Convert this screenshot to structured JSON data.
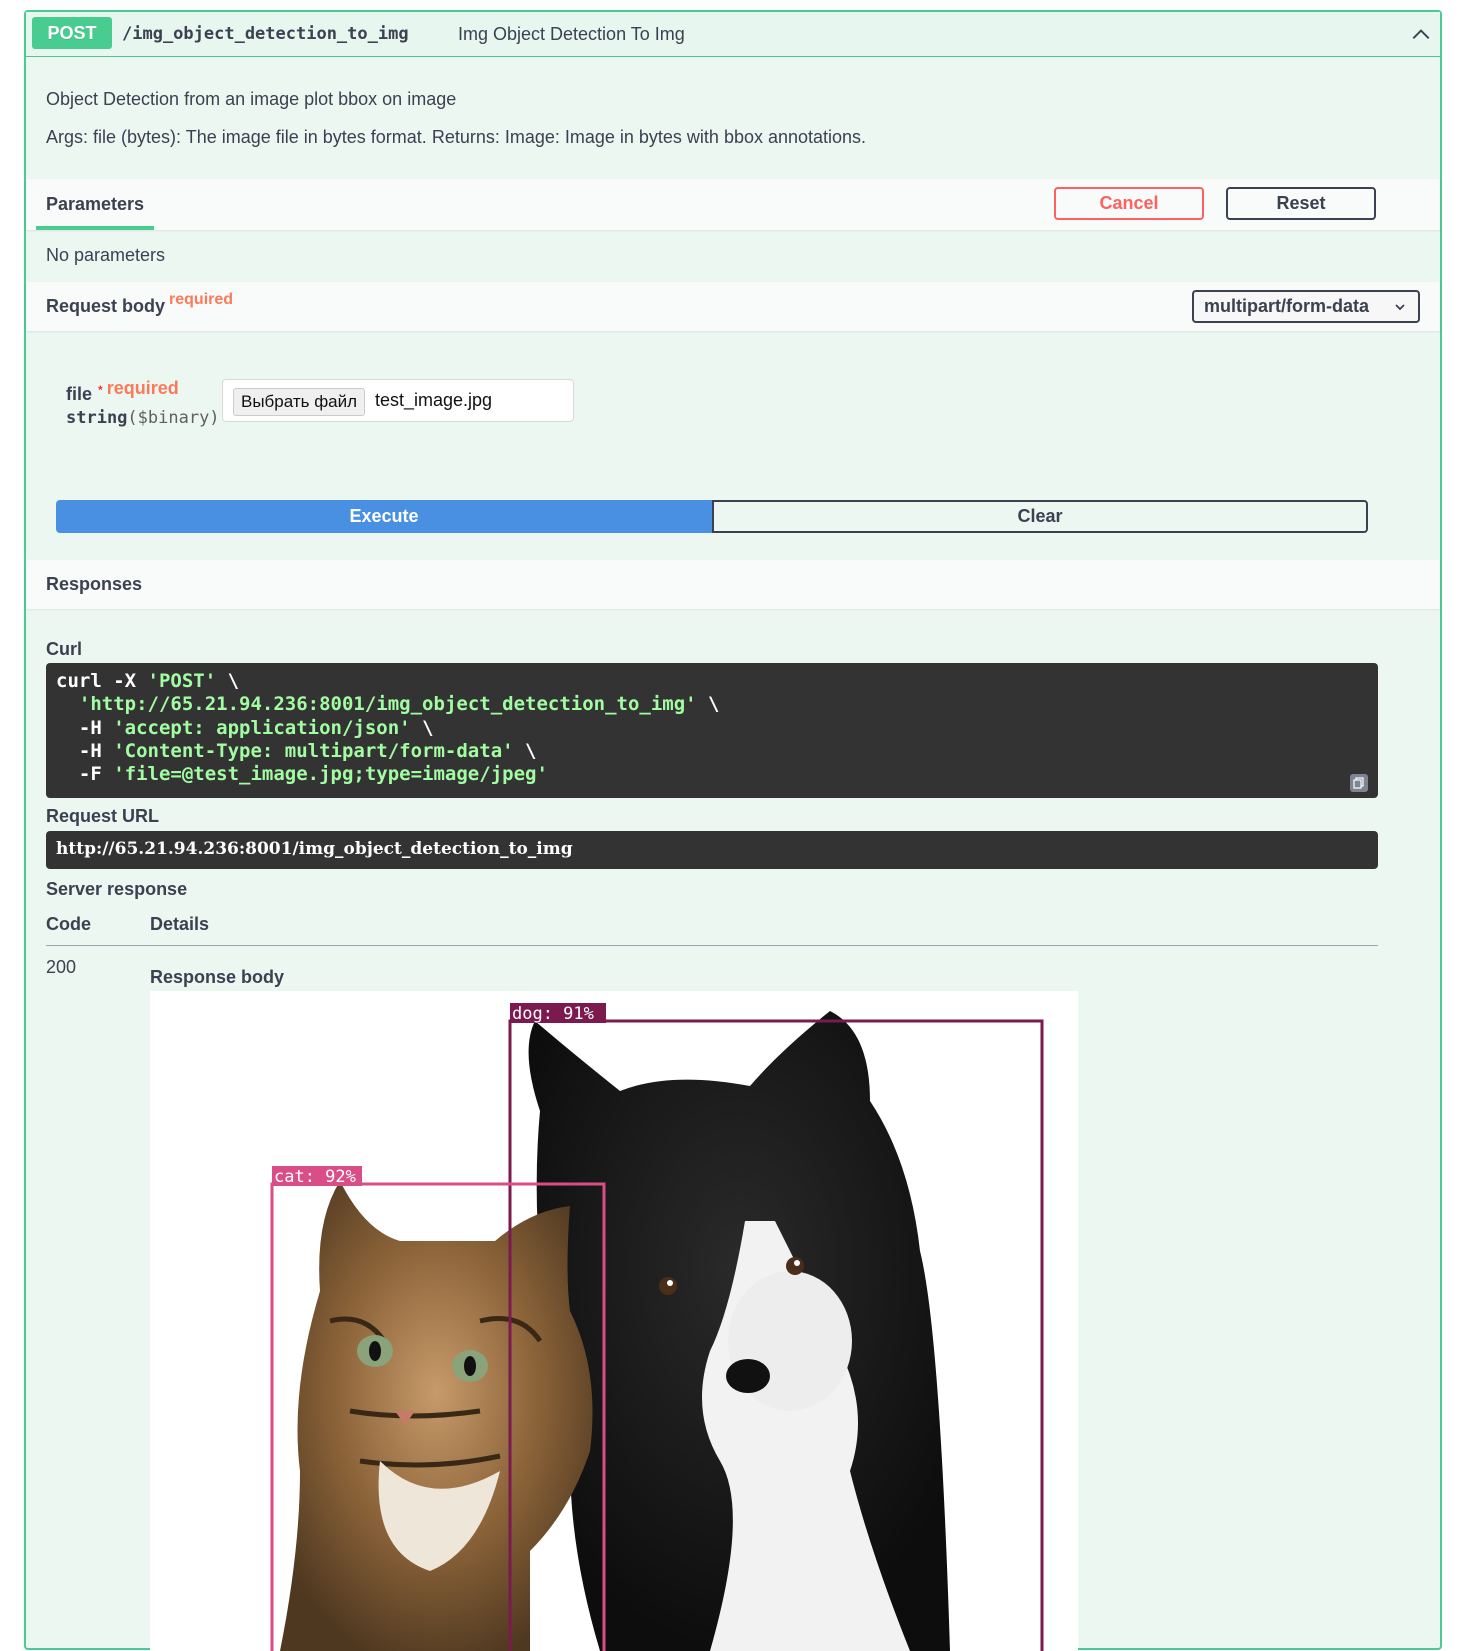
{
  "operation": {
    "method": "POST",
    "path": "/img_object_detection_to_img",
    "summary": "Img Object Detection To Img",
    "description": "Object Detection from an image plot bbox on image",
    "args": "Args: file (bytes): The image file in bytes format. Returns: Image: Image in bytes with bbox annotations."
  },
  "parameters": {
    "tab_label": "Parameters",
    "cancel_label": "Cancel",
    "reset_label": "Reset",
    "no_params": "No parameters"
  },
  "request_body": {
    "label": "Request body",
    "required": "required",
    "content_type": "multipart/form-data",
    "file": {
      "name": "file",
      "star": "*",
      "required": "required",
      "type": "string",
      "format": "($binary)",
      "choose_label": "Выбрать файл",
      "file_name": "test_image.jpg"
    }
  },
  "actions": {
    "execute": "Execute",
    "clear": "Clear"
  },
  "responses": {
    "title": "Responses",
    "curl_label": "Curl",
    "curl_lines": [
      {
        "plain": "curl -X ",
        "str": "'POST'",
        "tail": " \\"
      },
      {
        "plain": "  ",
        "str": "'http://65.21.94.236:8001/img_object_detection_to_img'",
        "tail": " \\"
      },
      {
        "plain": "  -H ",
        "str": "'accept: application/json'",
        "tail": " \\"
      },
      {
        "plain": "  -H ",
        "str": "'Content-Type: multipart/form-data'",
        "tail": " \\"
      },
      {
        "plain": "  -F ",
        "str": "'file=@test_image.jpg;type=image/jpeg'",
        "tail": ""
      }
    ],
    "request_url_label": "Request URL",
    "request_url": "http://65.21.94.236:8001/img_object_detection_to_img",
    "server_response_label": "Server response",
    "col_code": "Code",
    "col_details": "Details",
    "code": "200",
    "response_body_label": "Response body",
    "detections": [
      {
        "label": "dog: 91%",
        "color": "#7a1a4e"
      },
      {
        "label": "cat: 92%",
        "color": "#d94e86"
      }
    ]
  },
  "colors": {
    "accent": "#49cc90",
    "execute": "#4990e2",
    "cancel": "#ff6060",
    "required": "#fa7a5a",
    "code_bg": "#333333",
    "code_string": "#a2fca2"
  }
}
